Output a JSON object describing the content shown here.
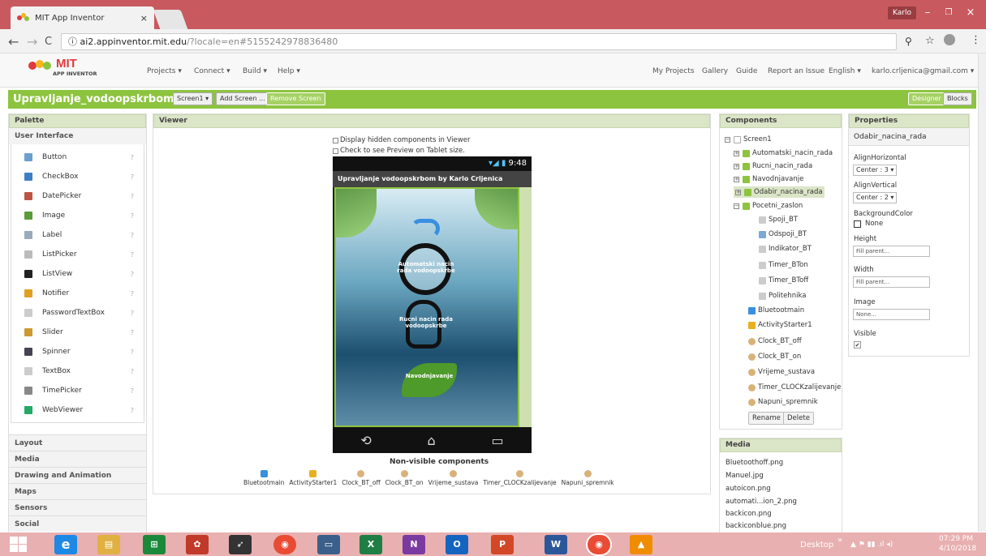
{
  "browser": {
    "tab_title": "MIT App Inventor",
    "tab_close": "×",
    "user": "Karlo",
    "url_host": "ai2.appinventor.mit.edu",
    "url_path": "/?locale=en#5155242978836480",
    "win_min": "–",
    "win_max": "❐",
    "win_close": "×",
    "back": "←",
    "forward": "→",
    "reload": "C",
    "info": "ⓘ",
    "zoom": "⚲",
    "star": "☆",
    "menu": "⋮"
  },
  "header": {
    "logo_top": "MIT",
    "logo_bottom": "APP INVENTOR",
    "menu_projects": "Projects ▾",
    "menu_connect": "Connect ▾",
    "menu_build": "Build ▾",
    "menu_help": "Help ▾",
    "my_projects": "My Projects",
    "gallery": "Gallery",
    "guide": "Guide",
    "report": "Report an Issue",
    "language": "English ▾",
    "account": "karlo.crljenica@gmail.com ▾"
  },
  "project": {
    "name": "Upravljanje_vodoopskrbom_copy",
    "screen_select": "Screen1 ▾",
    "add_screen": "Add Screen ...",
    "remove_screen": "Remove Screen",
    "designer": "Designer",
    "blocks": "Blocks"
  },
  "palette": {
    "title": "Palette",
    "section_ui": "User Interface",
    "items": [
      {
        "label": "Button",
        "color": "#6a9fd0"
      },
      {
        "label": "CheckBox",
        "color": "#3c7fc4"
      },
      {
        "label": "DatePicker",
        "color": "#b54"
      },
      {
        "label": "Image",
        "color": "#5a9c3a"
      },
      {
        "label": "Label",
        "color": "#9ab"
      },
      {
        "label": "ListPicker",
        "color": "#bbb"
      },
      {
        "label": "ListView",
        "color": "#222"
      },
      {
        "label": "Notifier",
        "color": "#e0a020"
      },
      {
        "label": "PasswordTextBox",
        "color": "#ccc"
      },
      {
        "label": "Slider",
        "color": "#c93"
      },
      {
        "label": "Spinner",
        "color": "#445"
      },
      {
        "label": "TextBox",
        "color": "#ccc"
      },
      {
        "label": "TimePicker",
        "color": "#888"
      },
      {
        "label": "WebViewer",
        "color": "#2a6"
      }
    ],
    "help_glyph": "?",
    "sections": [
      "Layout",
      "Media",
      "Drawing and Animation",
      "Maps",
      "Sensors",
      "Social"
    ]
  },
  "viewer": {
    "title": "Viewer",
    "cb_hidden": "Display hidden components in Viewer",
    "cb_tablet": "Check to see Preview on Tablet size.",
    "clock": "9:48",
    "app_title": "Upravljanje vodoopskrbom by Karlo Crljenica",
    "btn_auto": "Automatski nacin rada vodoopskrbe",
    "btn_manual": "Rucni nacin rada vodoopskrbe",
    "btn_irrigation": "Navodnjavanje",
    "nav_back": "⟲",
    "nav_home": "⌂",
    "nav_recent": "▭",
    "nonvisible_title": "Non-visible components",
    "nonvisible": [
      {
        "label": "Bluetootmain",
        "color": "#3a8fe0"
      },
      {
        "label": "ActivityStarter1",
        "color": "#e8b020"
      },
      {
        "label": "Clock_BT_off",
        "color": "#d9b27a"
      },
      {
        "label": "Clock_BT_on",
        "color": "#d9b27a"
      },
      {
        "label": "Vrijeme_sustava",
        "color": "#d9b27a"
      },
      {
        "label": "Timer_CLOCKzalijevanje",
        "color": "#d9b27a"
      },
      {
        "label": "Napuni_spremnik",
        "color": "#d9b27a"
      }
    ]
  },
  "components": {
    "title": "Components",
    "items": [
      {
        "label": "Screen1",
        "toggle": "−",
        "color": "#ddd"
      },
      {
        "label": "Automatski_nacin_rada",
        "toggle": "+",
        "color": "#8dc43f"
      },
      {
        "label": "Rucni_nacin_rada",
        "toggle": "+",
        "color": "#8dc43f"
      },
      {
        "label": "Navodnjavanje",
        "toggle": "+",
        "color": "#8dc43f"
      },
      {
        "label": "Odabir_nacina_rada",
        "toggle": "+",
        "color": "#8dc43f"
      },
      {
        "label": "Pocetni_zaslon",
        "toggle": "−",
        "color": "#8dc43f"
      },
      {
        "label": "Spoji_BT",
        "color": "#ccc"
      },
      {
        "label": "Odspoji_BT",
        "color": "#7aa8d8"
      },
      {
        "label": "Indikator_BT",
        "color": "#ccc"
      },
      {
        "label": "Timer_BTon",
        "color": "#ccc"
      },
      {
        "label": "Timer_BToff",
        "color": "#ccc"
      },
      {
        "label": "Politehnika",
        "color": "#ccc"
      },
      {
        "label": "Bluetootmain",
        "color": "#3a8fe0"
      },
      {
        "label": "ActivityStarter1",
        "color": "#e8b020"
      },
      {
        "label": "Clock_BT_off",
        "color": "#d9b27a"
      },
      {
        "label": "Clock_BT_on",
        "color": "#d9b27a"
      },
      {
        "label": "Vrijeme_sustava",
        "color": "#d9b27a"
      },
      {
        "label": "Timer_CLOCKzalijevanje",
        "color": "#d9b27a"
      },
      {
        "label": "Napuni_spremnik",
        "color": "#d9b27a"
      }
    ],
    "rename": "Rename",
    "delete": "Delete"
  },
  "media": {
    "title": "Media",
    "files": [
      "Bluetoothoff.png",
      "Manuel.jpg",
      "autoicon.png",
      "automati...ion_2.png",
      "backicon.png",
      "backiconblue.png"
    ]
  },
  "properties": {
    "title": "Properties",
    "component": "Odabir_nacina_rada",
    "align_h_label": "AlignHorizontal",
    "align_h_value": "Center : 3 ▾",
    "align_v_label": "AlignVertical",
    "align_v_value": "Center : 2 ▾",
    "bg_label": "BackgroundColor",
    "bg_value": "None",
    "height_label": "Height",
    "height_value": "Fill parent...",
    "width_label": "Width",
    "width_value": "Fill parent...",
    "image_label": "Image",
    "image_value": "None...",
    "visible_label": "Visible",
    "visible_check": "✔"
  },
  "taskbar": {
    "desktop": "Desktop",
    "chevron": "»",
    "time": "07:29 PM",
    "date": "4/10/2018",
    "tray": "▲ ⚑ ▮▮ .ıl ◂)",
    "apps": [
      {
        "label": "e",
        "color": "#1e88e5"
      },
      {
        "label": "▤",
        "color": "#e0b040"
      },
      {
        "label": "⊞",
        "color": "#1a8a3a"
      },
      {
        "label": "✿",
        "color": "#c0392b"
      },
      {
        "label": "➶",
        "color": "#333"
      },
      {
        "label": "◉",
        "color": "#e94b35"
      },
      {
        "label": "▭",
        "color": "#3a5f8a"
      },
      {
        "label": "X",
        "color": "#1e7e44"
      },
      {
        "label": "N",
        "color": "#7b3aa0"
      },
      {
        "label": "O",
        "color": "#1565c0"
      },
      {
        "label": "P",
        "color": "#d24726"
      },
      {
        "label": "W",
        "color": "#2b579a"
      },
      {
        "label": "◉",
        "color": "#e94b35"
      },
      {
        "label": "▲",
        "color": "#f08c00"
      }
    ]
  }
}
